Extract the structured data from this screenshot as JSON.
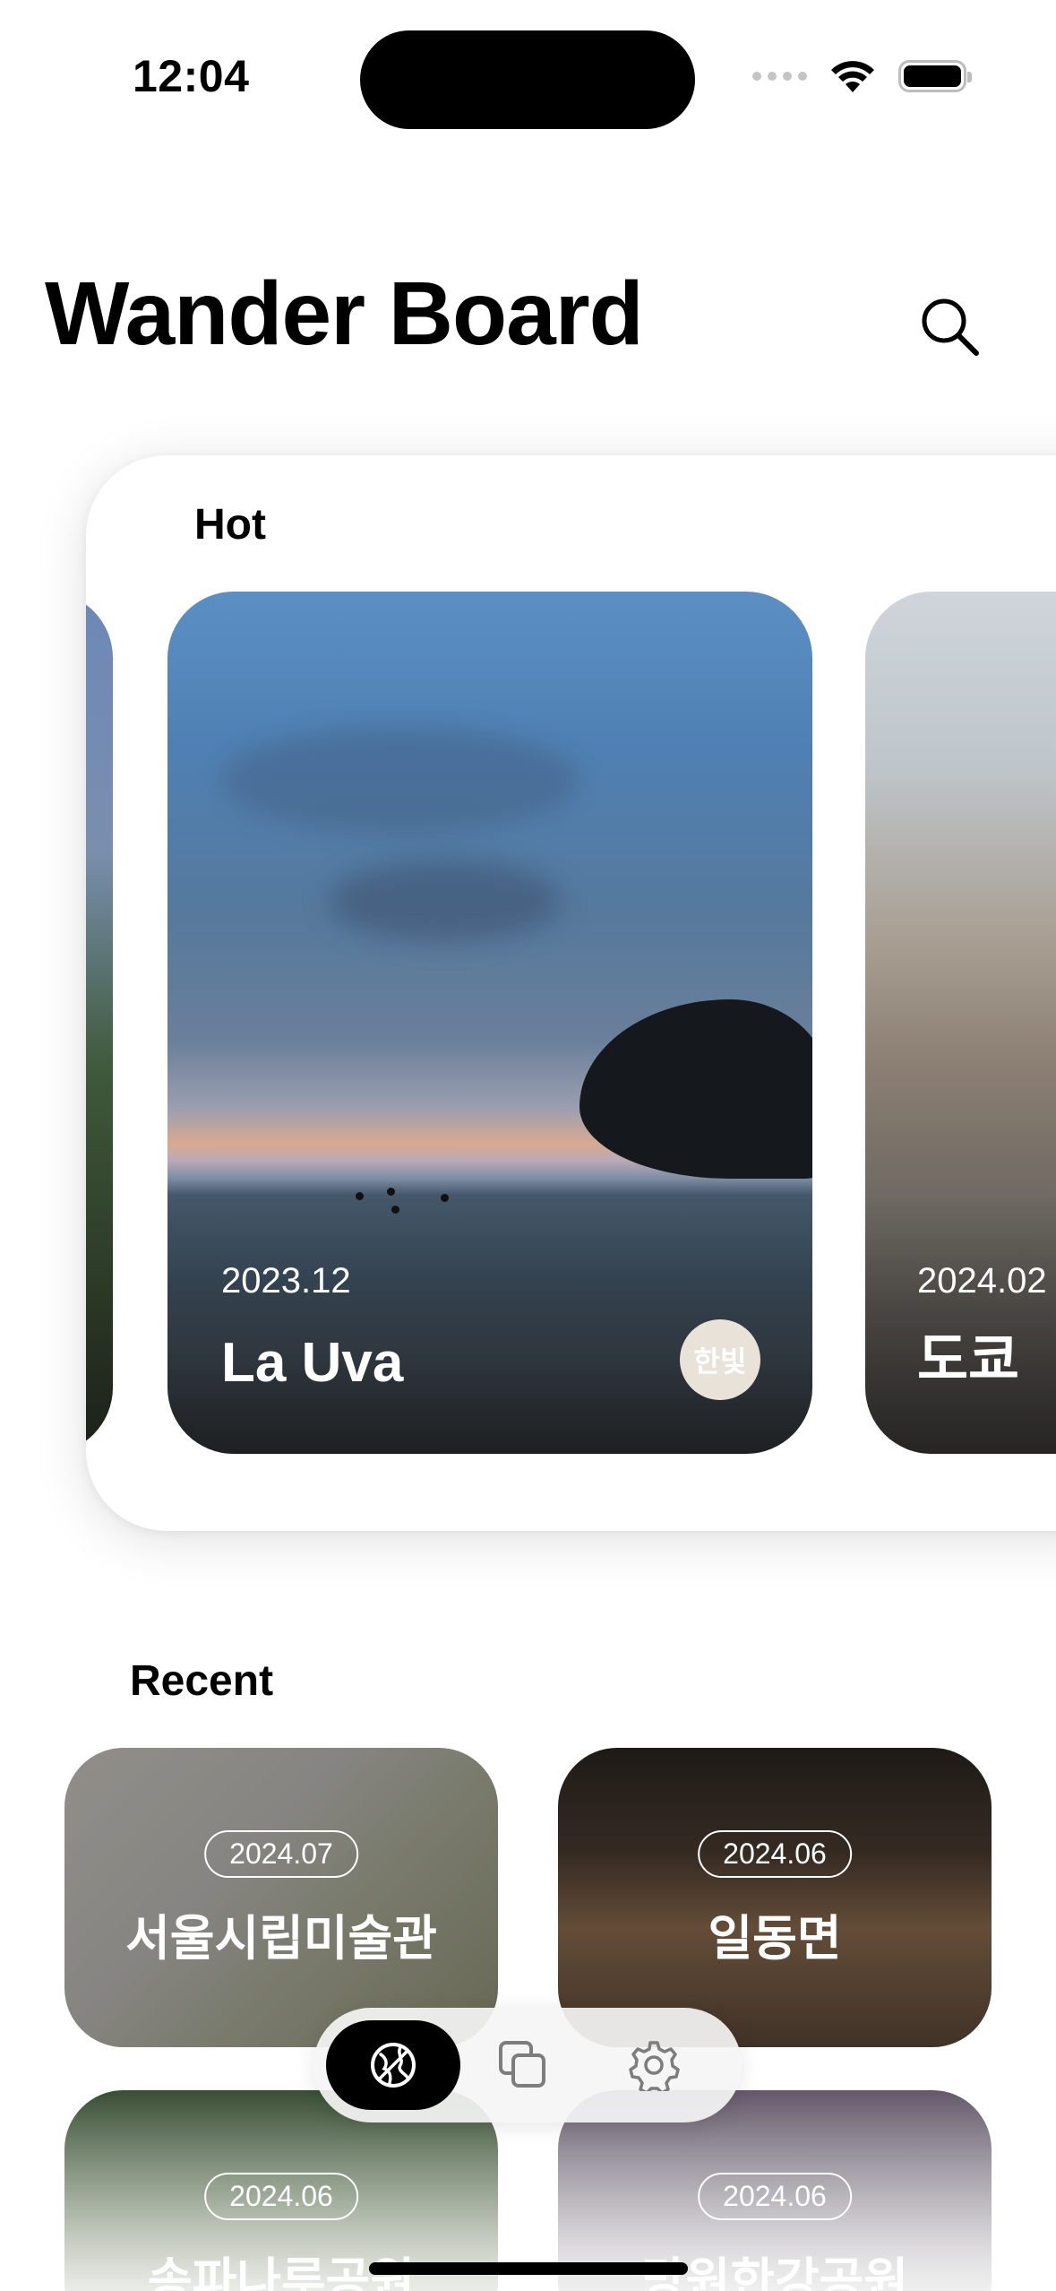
{
  "status_bar": {
    "time": "12:04"
  },
  "header": {
    "title": "Wander Board"
  },
  "hot": {
    "label": "Hot",
    "cards": [
      {
        "date": "2023.12",
        "title": "La Uva",
        "author": "한빛"
      },
      {
        "date": "2024.02",
        "title": "도쿄"
      }
    ]
  },
  "recent": {
    "label": "Recent",
    "items": [
      {
        "date": "2024.07",
        "title": "서울시립미술관"
      },
      {
        "date": "2024.06",
        "title": "일동면"
      },
      {
        "date": "2024.06",
        "title": "송파나루공원"
      },
      {
        "date": "2024.06",
        "title": "망원한강공원"
      }
    ]
  },
  "tabbar": {
    "tabs": [
      {
        "icon": "globe-icon",
        "active": true
      },
      {
        "icon": "collections-icon",
        "active": false
      },
      {
        "icon": "gear-icon",
        "active": false
      }
    ]
  }
}
